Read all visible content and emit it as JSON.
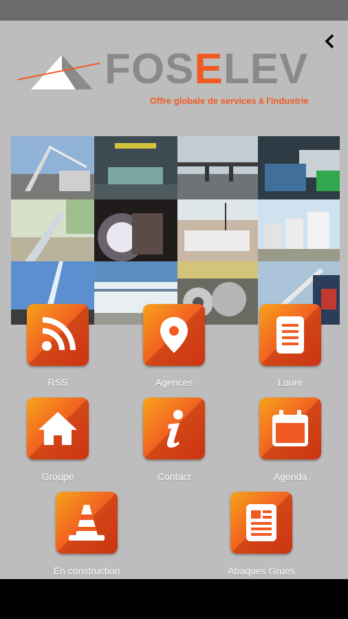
{
  "brand": {
    "logo_prefix": "FOS",
    "logo_highlight": "E",
    "logo_suffix": "LEV",
    "tagline": "Offre globale de services à l'industrie",
    "accent": "#f15a22",
    "grey": "#8a8a8a"
  },
  "nav": {
    "back_icon": "chevron-left-icon"
  },
  "photos": [
    {
      "name": "crane-tower-photo"
    },
    {
      "name": "industrial-hall-photo"
    },
    {
      "name": "pier-structure-photo"
    },
    {
      "name": "factory-interior-photo"
    },
    {
      "name": "pipeline-photo"
    },
    {
      "name": "welding-photo"
    },
    {
      "name": "crane-lift-photo"
    },
    {
      "name": "storage-tanks-photo"
    },
    {
      "name": "crane-boom-photo"
    },
    {
      "name": "modular-buildings-photo"
    },
    {
      "name": "steel-coils-photo"
    },
    {
      "name": "mobile-crane-photo"
    }
  ],
  "menu": [
    {
      "label": "RSS",
      "icon": "rss-icon"
    },
    {
      "label": "Agences",
      "icon": "location-pin-icon"
    },
    {
      "label": "Louer",
      "icon": "document-icon"
    },
    {
      "label": "Groupe",
      "icon": "home-icon"
    },
    {
      "label": "Contact",
      "icon": "info-icon"
    },
    {
      "label": "Agenda",
      "icon": "calendar-icon"
    },
    {
      "label": "En construction",
      "icon": "traffic-cone-icon"
    },
    {
      "label": "Abaques Grues",
      "icon": "newspaper-icon"
    }
  ]
}
